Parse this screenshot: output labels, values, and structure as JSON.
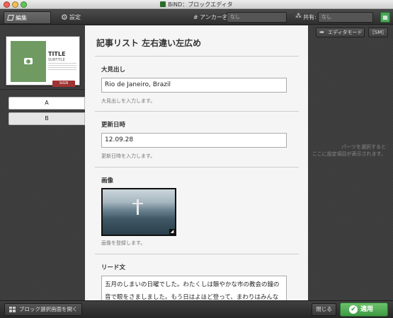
{
  "window": {
    "title": "BiND：ブロックエディタ"
  },
  "toolbar": {
    "tab_edit": "編集",
    "tab_settings": "設定",
    "anchor_label": "# アンカー名:",
    "anchor_value": "なし",
    "share_label": "共有:",
    "share_value": "なし"
  },
  "left": {
    "preview": {
      "title": "TITLE",
      "subtitle": "SUBTITLE",
      "button": "SiGN"
    },
    "variants": [
      "A",
      "B"
    ]
  },
  "main": {
    "heading": "記事リスト 左右違い左広め",
    "sections": {
      "headline": {
        "label": "大見出し",
        "value": "Rio de Janeiro, Brazil",
        "hint": "大見出しを入力します。"
      },
      "date": {
        "label": "更新日時",
        "value": "12.09.28",
        "hint": "更新日時を入力します。"
      },
      "image": {
        "label": "画像",
        "hint": "画像を登録します。"
      },
      "lead": {
        "label": "リード文",
        "value": "五月のしまいの日曜でした。わたくしは賑やかな市の教会の鐘の音で眼をさましました。もう日はよほど登って、まわりはみんな"
      }
    }
  },
  "right": {
    "editor_mode": "エディタモード",
    "sm": "［SM］",
    "message_line1": "パーツを選択すると",
    "message_line2": "ここに設定項目が表示されます。"
  },
  "bottom": {
    "open_gallery": "ブロック選択画面を開く",
    "close": "閉じる",
    "apply": "適用"
  },
  "colors": {
    "accent_green": "#4aa45a",
    "sign_red": "#a03333"
  }
}
